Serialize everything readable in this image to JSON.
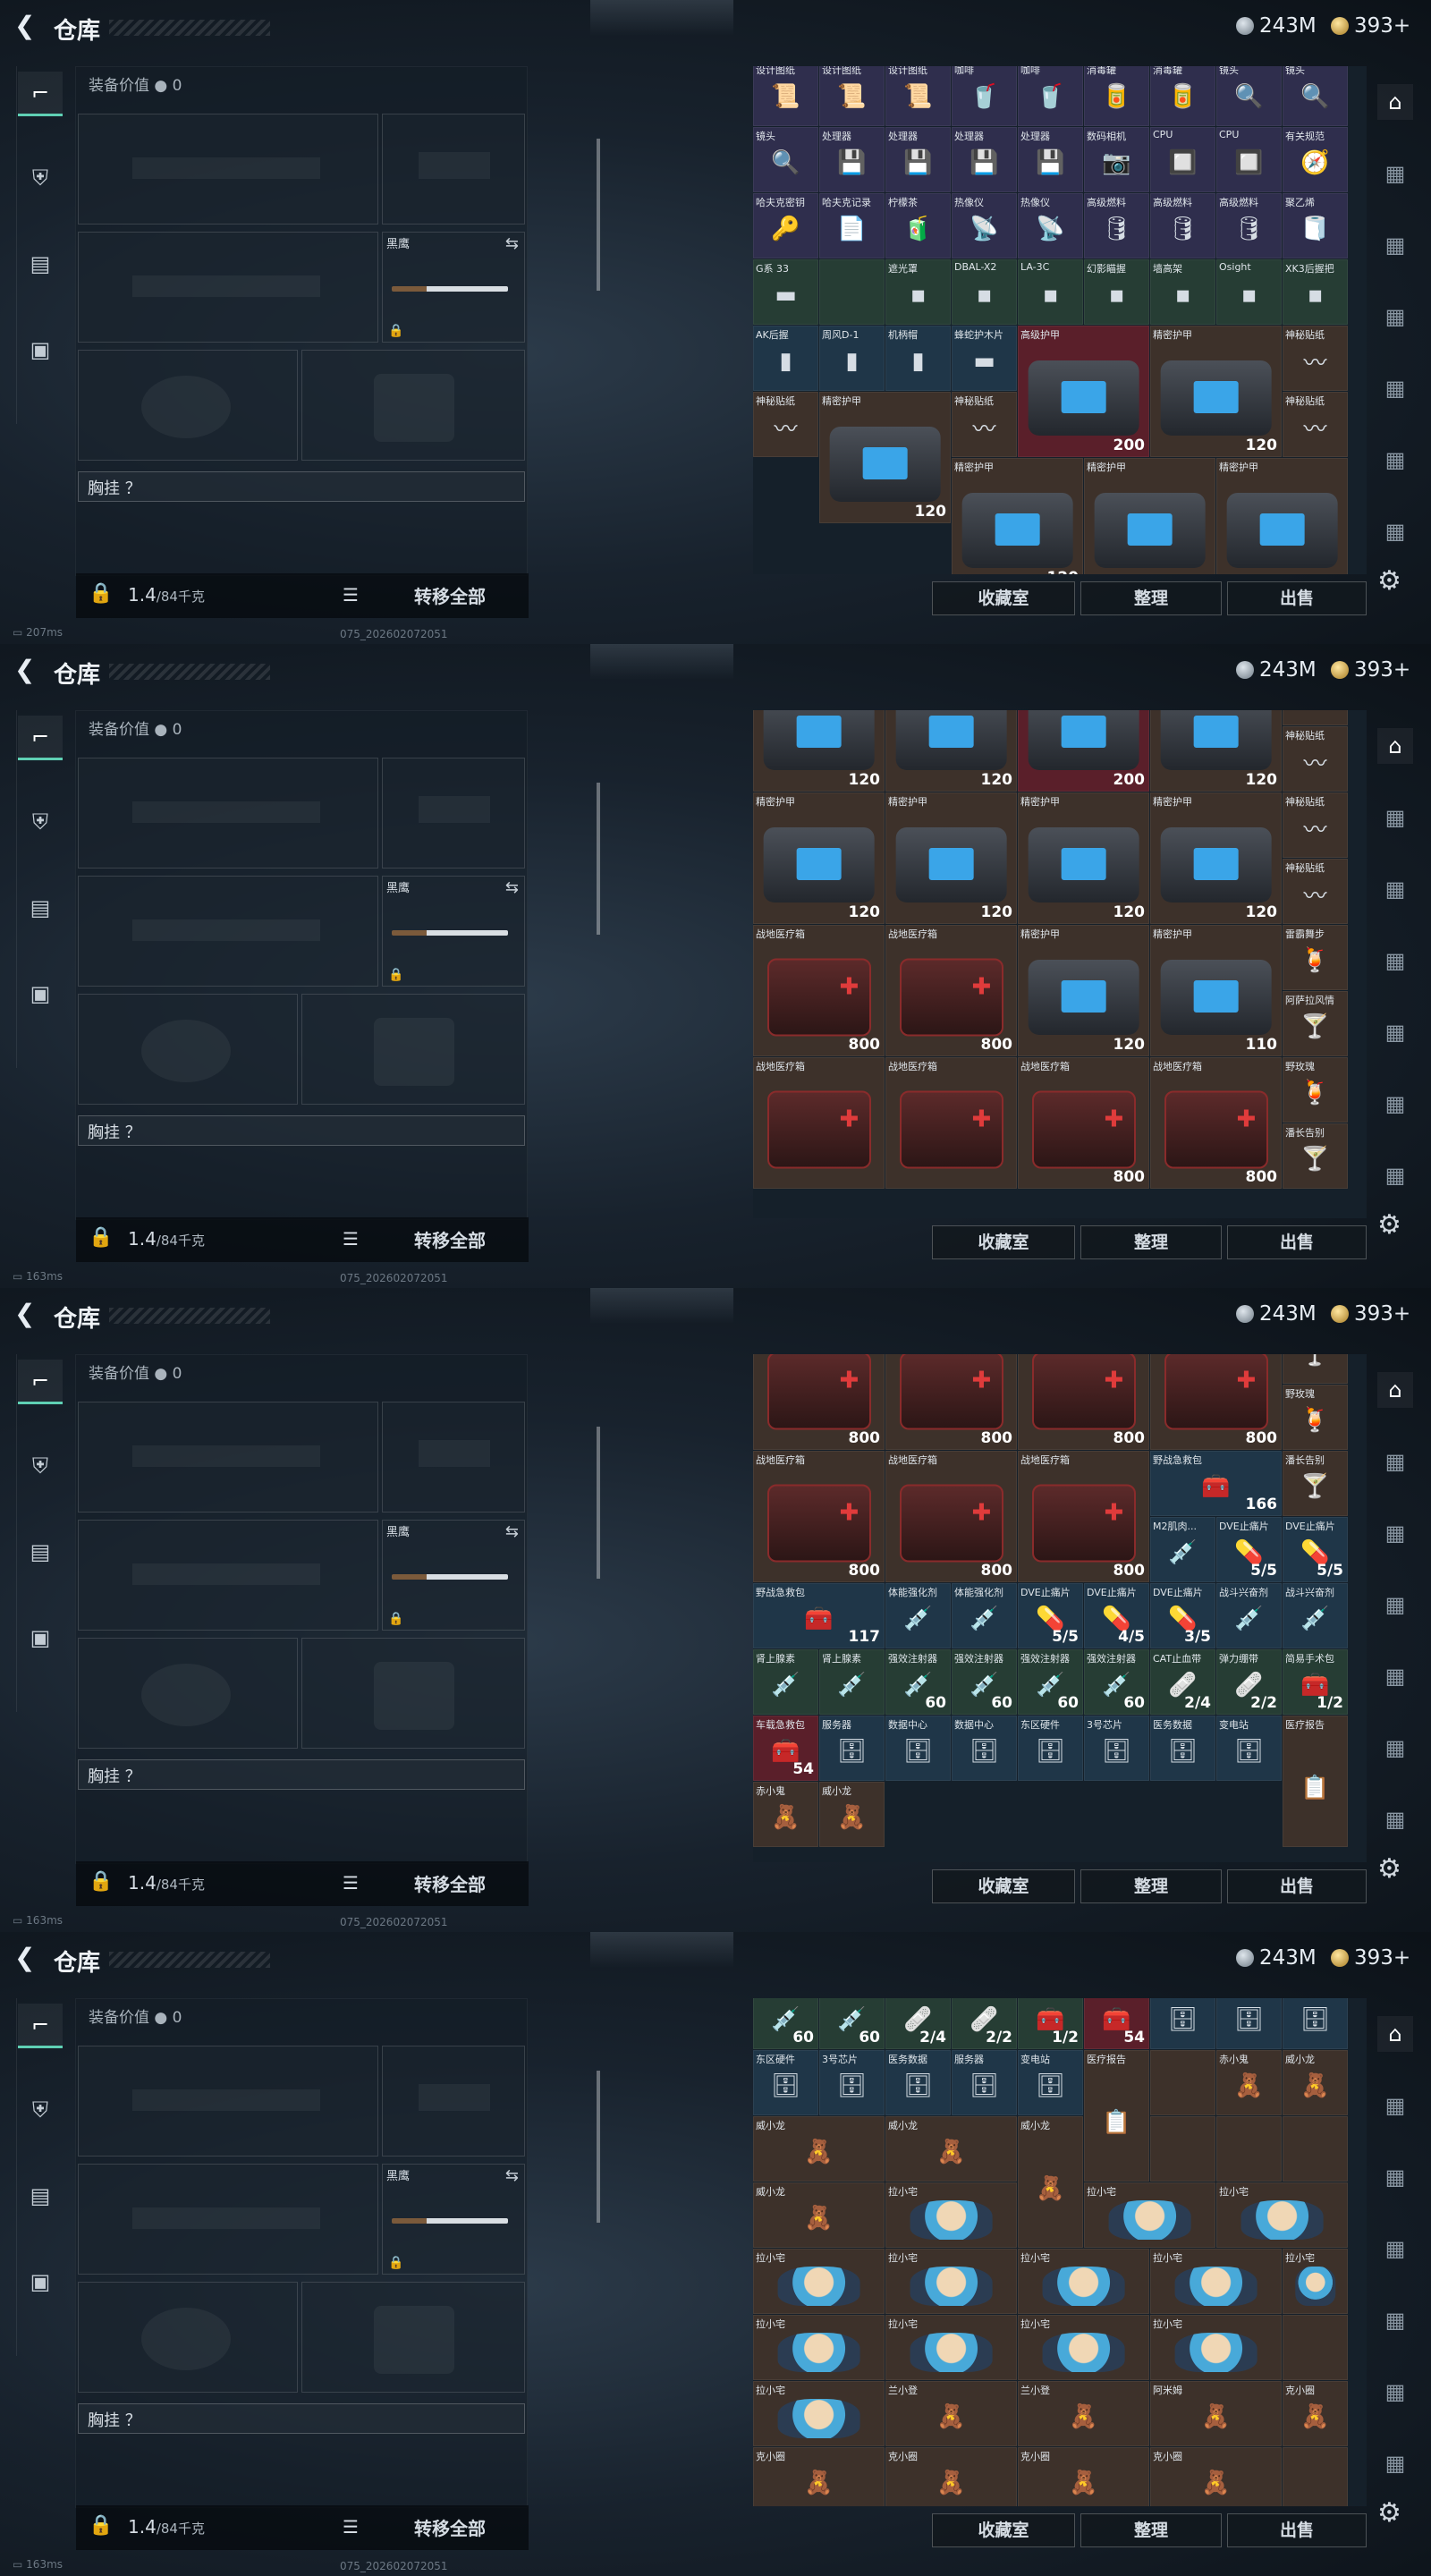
{
  "page": {
    "title": "仓库",
    "back_icon": "back-arrow-icon"
  },
  "currency": {
    "silver": "243M",
    "gold": "393+"
  },
  "equipment": {
    "value_label": "装备价值",
    "value": "0",
    "melee_label": "黑鹰",
    "chest_rig_label": "胸挂 ？",
    "weight": "1.4",
    "weight_cap": "/84千克",
    "transfer_label": "转移全部"
  },
  "stash_buttons": {
    "collection": "收藏室",
    "sort": "整理",
    "sell": "出售"
  },
  "frames": [
    {
      "status": "207ms",
      "build": "075_202602072051",
      "rows": [
        [
          [
            "设计图纸",
            "bg-purple",
            "📜",
            ""
          ],
          [
            "设计图纸",
            "bg-purple",
            "📜",
            ""
          ],
          [
            "设计图纸",
            "bg-purple",
            "📜",
            ""
          ],
          [
            "咖啡",
            "bg-purple",
            "🥤",
            ""
          ],
          [
            "咖啡",
            "bg-purple",
            "🥤",
            ""
          ],
          [
            "消毒罐",
            "bg-purple",
            "🥫",
            ""
          ],
          [
            "消毒罐",
            "bg-purple",
            "🥫",
            ""
          ],
          [
            "镜头",
            "bg-purple",
            "🔍",
            ""
          ],
          [
            "镜头",
            "bg-purple",
            "🔍",
            ""
          ]
        ],
        [
          [
            "镜头",
            "bg-purple",
            "🔍",
            ""
          ],
          [
            "处理器",
            "bg-purple",
            "💾",
            ""
          ],
          [
            "处理器",
            "bg-purple",
            "💾",
            ""
          ],
          [
            "处理器",
            "bg-purple",
            "💾",
            ""
          ],
          [
            "处理器",
            "bg-purple",
            "💾",
            ""
          ],
          [
            "数码相机",
            "bg-purple",
            "📷",
            ""
          ],
          [
            "CPU",
            "bg-purple",
            "🔲",
            ""
          ],
          [
            "CPU",
            "bg-purple",
            "🔲",
            ""
          ],
          [
            "有关规范",
            "bg-purple",
            "🧭",
            ""
          ]
        ],
        [
          [
            "哈夫克密钥",
            "bg-purple",
            "🔑",
            ""
          ],
          [
            "哈夫克记录",
            "bg-purple",
            "📄",
            ""
          ],
          [
            "柠檬茶",
            "bg-purple",
            "🧃",
            ""
          ],
          [
            "热像仪",
            "bg-purple",
            "📡",
            ""
          ],
          [
            "热像仪",
            "bg-purple",
            "📡",
            ""
          ],
          [
            "高级燃料",
            "bg-purple",
            "🛢",
            ""
          ],
          [
            "高级燃料",
            "bg-purple",
            "🛢",
            ""
          ],
          [
            "高级燃料",
            "bg-purple",
            "🛢",
            ""
          ],
          [
            "聚乙烯",
            "bg-purple",
            "🧻",
            ""
          ]
        ],
        [
          [
            "G系 33",
            "bg-green",
            "▬",
            ""
          ],
          [
            "",
            "bg-green",
            "",
            ""
          ],
          [
            "遮光罩",
            "bg-green",
            "▪",
            ""
          ],
          [
            "DBAL-X2",
            "bg-green",
            "▪",
            ""
          ],
          [
            "LA-3C",
            "bg-green",
            "▪",
            ""
          ],
          [
            "幻影瞄握",
            "bg-green",
            "▪",
            ""
          ],
          [
            "墙高架",
            "bg-green",
            "▪",
            ""
          ],
          [
            "Osight",
            "bg-green",
            "▪",
            ""
          ],
          [
            "XK3后握把",
            "bg-green",
            "▪",
            ""
          ]
        ],
        [
          [
            "AK后握",
            "bg-blue",
            "▮",
            ""
          ],
          [
            "周风D-1",
            "bg-blue",
            "▮",
            ""
          ],
          [
            "机柄帽",
            "bg-blue",
            "▮",
            ""
          ],
          [
            "蜂蛇护木片",
            "bg-blue",
            "▬",
            ""
          ],
          [
            "高级护甲",
            "bg-red",
            "BAG",
            "200",
            "s2x2"
          ],
          [
            "精密护甲",
            "bg-brown",
            "BAG",
            "120",
            "s2x2"
          ],
          [
            "神秘贴纸",
            "bg-brown",
            "〰",
            ""
          ]
        ],
        [
          [
            "神秘贴纸",
            "bg-brown",
            "〰",
            ""
          ]
        ],
        [
          [
            "精密护甲",
            "bg-brown",
            "BAG",
            "120",
            "s2x2"
          ],
          [
            "精密护甲",
            "bg-brown",
            "BAG",
            "120",
            "s2x2"
          ],
          [
            "精密护甲",
            "bg-brown",
            "BAG",
            "",
            "s2x2"
          ],
          [
            "精密护甲",
            "bg-brown",
            "BAG",
            "",
            "s2x2"
          ],
          [
            "神秘贴纸",
            "bg-brown",
            "〰",
            ""
          ]
        ],
        [
          [
            "神秘贴纸",
            "bg-brown",
            "〰",
            ""
          ]
        ]
      ]
    },
    {
      "status": "163ms",
      "build": "075_202602072051",
      "rows": [
        [
          [
            "精密护甲",
            "bg-brown",
            "BAG",
            "120",
            "s2x2"
          ],
          [
            "精密护甲",
            "bg-brown",
            "BAG",
            "120",
            "s2x2"
          ],
          [
            "精密护甲",
            "bg-red",
            "BAG",
            "200",
            "s2x2"
          ],
          [
            "精密护甲",
            "bg-brown",
            "BAG",
            "120",
            "s2x2"
          ],
          [
            "神秘贴纸",
            "bg-brown",
            "〰",
            ""
          ]
        ],
        [
          [
            "神秘贴纸",
            "bg-brown",
            "〰",
            ""
          ]
        ],
        [
          [
            "精密护甲",
            "bg-brown",
            "BAG",
            "120",
            "s2x2"
          ],
          [
            "精密护甲",
            "bg-brown",
            "BAG",
            "120",
            "s2x2"
          ],
          [
            "精密护甲",
            "bg-brown",
            "BAG",
            "120",
            "s2x2"
          ],
          [
            "精密护甲",
            "bg-brown",
            "BAG",
            "120",
            "s2x2"
          ],
          [
            "神秘贴纸",
            "bg-brown",
            "〰",
            ""
          ]
        ],
        [
          [
            "神秘贴纸",
            "bg-brown",
            "〰",
            ""
          ]
        ],
        [
          [
            "战地医疗箱",
            "bg-brown",
            "MED",
            "800",
            "s2x2"
          ],
          [
            "战地医疗箱",
            "bg-brown",
            "MED",
            "800",
            "s2x2"
          ],
          [
            "精密护甲",
            "bg-brown",
            "BAG",
            "120",
            "s2x2"
          ],
          [
            "精密护甲",
            "bg-brown",
            "BAG",
            "110",
            "s2x2"
          ],
          [
            "雷霸舞步",
            "bg-brown",
            "🍹",
            ""
          ]
        ],
        [
          [
            "阿萨拉风情",
            "bg-brown",
            "🍸",
            ""
          ]
        ],
        [
          [
            "战地医疗箱",
            "bg-brown",
            "MED",
            "",
            "s2x2"
          ],
          [
            "战地医疗箱",
            "bg-brown",
            "MED",
            "",
            "s2x2"
          ],
          [
            "战地医疗箱",
            "bg-brown",
            "MED",
            "800",
            "s2x2"
          ],
          [
            "战地医疗箱",
            "bg-brown",
            "MED",
            "800",
            "s2x2"
          ],
          [
            "野玫瑰",
            "bg-brown",
            "🍹",
            ""
          ]
        ],
        [
          [
            "潘长告别",
            "bg-brown",
            "🍸",
            ""
          ]
        ]
      ]
    },
    {
      "status": "163ms",
      "build": "075_202602072051",
      "rows": [
        [
          [
            "战地医疗箱",
            "bg-brown",
            "MED",
            "800",
            "s2x2"
          ],
          [
            "战地医疗箱",
            "bg-brown",
            "MED",
            "800",
            "s2x2"
          ],
          [
            "战地医疗箱",
            "bg-brown",
            "MED",
            "800",
            "s2x2"
          ],
          [
            "战地医疗箱",
            "bg-brown",
            "MED",
            "800",
            "s2x2"
          ],
          [
            "阿萨拉风情",
            "bg-brown",
            "🍸",
            ""
          ]
        ],
        [
          [
            "野玫瑰",
            "bg-brown",
            "🍹",
            ""
          ]
        ],
        [
          [
            "战地医疗箱",
            "bg-brown",
            "MED",
            "800",
            "s2x2"
          ],
          [
            "战地医疗箱",
            "bg-brown",
            "MED",
            "800",
            "s2x2"
          ],
          [
            "战地医疗箱",
            "bg-brown",
            "MED",
            "800",
            "s2x2"
          ],
          [
            "野战急救包",
            "bg-blue",
            "🧰",
            "166",
            "s2x1"
          ],
          [
            "潘长告别",
            "bg-brown",
            "🍸",
            ""
          ]
        ],
        [
          [
            "M2肌肉...",
            "bg-blue",
            "💉",
            ""
          ],
          [
            "DVE止痛片",
            "bg-blue",
            "💊",
            "5/5"
          ],
          [
            "DVE止痛片",
            "bg-blue",
            "💊",
            "5/5"
          ]
        ],
        [
          [
            "野战急救包",
            "bg-blue",
            "🧰",
            "117",
            "s2x1"
          ],
          [
            "体能强化剂",
            "bg-blue",
            "💉",
            ""
          ],
          [
            "体能强化剂",
            "bg-blue",
            "💉",
            ""
          ],
          [
            "DVE止痛片",
            "bg-blue",
            "💊",
            "5/5"
          ],
          [
            "DVE止痛片",
            "bg-blue",
            "💊",
            "4/5"
          ],
          [
            "DVE止痛片",
            "bg-blue",
            "💊",
            "3/5"
          ],
          [
            "战斗兴奋剂",
            "bg-blue",
            "💉",
            ""
          ],
          [
            "战斗兴奋剂",
            "bg-blue",
            "💉",
            ""
          ]
        ],
        [
          [
            "肾上腺素",
            "bg-green",
            "💉",
            ""
          ],
          [
            "肾上腺素",
            "bg-green",
            "💉",
            ""
          ],
          [
            "强效注射器",
            "bg-green",
            "💉",
            "60"
          ],
          [
            "强效注射器",
            "bg-green",
            "💉",
            "60"
          ],
          [
            "强效注射器",
            "bg-green",
            "💉",
            "60"
          ],
          [
            "强效注射器",
            "bg-green",
            "💉",
            "60"
          ],
          [
            "CAT止血带",
            "bg-green",
            "🩹",
            "2/4"
          ],
          [
            "弹力绷带",
            "bg-green",
            "🩹",
            "2/2"
          ],
          [
            "简易手术包",
            "bg-green",
            "🧰",
            "1/2"
          ]
        ],
        [
          [
            "车载急救包",
            "bg-red",
            "🧰",
            "54"
          ],
          [
            "服务器",
            "bg-blue",
            "🗄",
            ""
          ],
          [
            "数据中心",
            "bg-blue",
            "🗄",
            ""
          ],
          [
            "数据中心",
            "bg-blue",
            "🗄",
            ""
          ],
          [
            "东区硬件",
            "bg-blue",
            "🗄",
            ""
          ],
          [
            "3号芯片",
            "bg-blue",
            "🗄",
            ""
          ],
          [
            "医务数据",
            "bg-blue",
            "🗄",
            ""
          ],
          [
            "变电站",
            "bg-blue",
            "🗄",
            ""
          ],
          [
            "医疗报告",
            "bg-brown",
            "📋",
            "",
            "s1x2"
          ]
        ],
        [
          [
            "赤小鬼",
            "bg-brown",
            "🧸",
            ""
          ],
          [
            "威小龙",
            "bg-brown",
            "🧸",
            ""
          ]
        ]
      ]
    },
    {
      "status": "163ms",
      "build": "075_202602072051",
      "rows": [
        [
          [
            "强效注射器",
            "bg-green",
            "💉",
            "60"
          ],
          [
            "强效注射器",
            "bg-green",
            "💉",
            "60"
          ],
          [
            "CAT止血带",
            "bg-green",
            "🩹",
            "2/4"
          ],
          [
            "弹力绷带",
            "bg-green",
            "🩹",
            "2/2"
          ],
          [
            "简易手术包",
            "bg-green",
            "🧰",
            "1/2"
          ],
          [
            "车载急救包",
            "bg-red",
            "🧰",
            "54"
          ],
          [
            "服务器",
            "bg-blue",
            "🗄",
            ""
          ],
          [
            "数据中心",
            "bg-blue",
            "🗄",
            ""
          ],
          [
            "数据中心",
            "bg-blue",
            "🗄",
            ""
          ]
        ],
        [
          [
            "东区硬件",
            "bg-blue",
            "🗄",
            ""
          ],
          [
            "3号芯片",
            "bg-blue",
            "🗄",
            ""
          ],
          [
            "医务数据",
            "bg-blue",
            "🗄",
            ""
          ],
          [
            "服务器",
            "bg-blue",
            "🗄",
            ""
          ],
          [
            "变电站",
            "bg-blue",
            "🗄",
            ""
          ],
          [
            "医疗报告",
            "bg-brown",
            "📋",
            "",
            "s1x2"
          ],
          [
            "",
            "bg-brown",
            "",
            ""
          ],
          [
            "赤小鬼",
            "bg-brown",
            "🧸",
            ""
          ],
          [
            "威小龙",
            "bg-brown",
            "🧸",
            ""
          ]
        ],
        [
          [
            "威小龙",
            "bg-brown",
            "🧸",
            "",
            "s2x1"
          ],
          [
            "威小龙",
            "bg-brown",
            "🧸",
            "",
            "s2x1"
          ],
          [
            "威小龙",
            "bg-brown",
            "🧸",
            "",
            "s1x2"
          ],
          [
            "",
            "bg-brown",
            "",
            ""
          ],
          [
            "",
            "bg-brown",
            "",
            ""
          ],
          [
            "",
            "bg-brown",
            "",
            ""
          ]
        ],
        [
          [
            "威小龙",
            "bg-brown",
            "🧸",
            "",
            "s2x1"
          ],
          [
            "拉小宅",
            "bg-brown",
            "DOLL",
            "",
            "s2x1"
          ],
          [
            "拉小宅",
            "bg-brown",
            "DOLL",
            "",
            "s2x1"
          ],
          [
            "拉小宅",
            "bg-brown",
            "DOLL",
            "",
            "s2x1"
          ]
        ],
        [
          [
            "拉小宅",
            "bg-brown",
            "DOLL",
            "",
            "s2x1"
          ],
          [
            "拉小宅",
            "bg-brown",
            "DOLL",
            "",
            "s2x1"
          ],
          [
            "拉小宅",
            "bg-brown",
            "DOLL",
            "",
            "s2x1"
          ],
          [
            "拉小宅",
            "bg-brown",
            "DOLL",
            "",
            "s2x1"
          ],
          [
            "拉小宅",
            "bg-brown",
            "DOLL",
            ""
          ]
        ],
        [
          [
            "拉小宅",
            "bg-brown",
            "DOLL",
            "",
            "s2x1"
          ],
          [
            "拉小宅",
            "bg-brown",
            "DOLL",
            "",
            "s2x1"
          ],
          [
            "拉小宅",
            "bg-brown",
            "DOLL",
            "",
            "s2x1"
          ],
          [
            "拉小宅",
            "bg-brown",
            "DOLL",
            "",
            "s2x1"
          ],
          [
            "",
            "bg-brown",
            "",
            ""
          ]
        ],
        [
          [
            "拉小宅",
            "bg-brown",
            "DOLL",
            "",
            "s2x1"
          ],
          [
            "兰小登",
            "bg-brown",
            "🧸",
            "",
            "s2x1"
          ],
          [
            "兰小登",
            "bg-brown",
            "🧸",
            "",
            "s2x1"
          ],
          [
            "阿米姆",
            "bg-brown",
            "🧸",
            "",
            "s2x1"
          ],
          [
            "克小圈",
            "bg-brown",
            "🧸",
            ""
          ]
        ],
        [
          [
            "克小圈",
            "bg-brown",
            "🧸",
            "",
            "s2x1"
          ],
          [
            "克小圈",
            "bg-brown",
            "🧸",
            "",
            "s2x1"
          ],
          [
            "克小圈",
            "bg-brown",
            "🧸",
            "",
            "s2x1"
          ],
          [
            "克小圈",
            "bg-brown",
            "🧸",
            "",
            "s2x1"
          ],
          [
            "",
            "bg-brown",
            "",
            ""
          ]
        ]
      ]
    }
  ],
  "frame_offsets": [
    -6,
    -56,
    -40,
    -16
  ]
}
